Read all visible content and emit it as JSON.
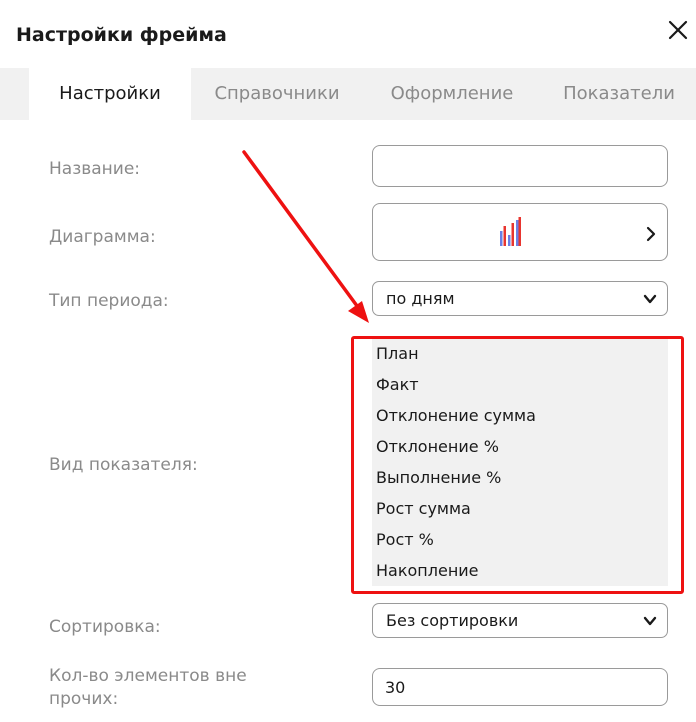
{
  "dialog": {
    "title": "Настройки фрейма"
  },
  "tabs": [
    {
      "label": "Настройки",
      "active": true
    },
    {
      "label": "Справочники",
      "active": false
    },
    {
      "label": "Оформление",
      "active": false
    },
    {
      "label": "Показатели",
      "active": false
    }
  ],
  "form": {
    "name_label": "Название:",
    "name_value": "",
    "diagram_label": "Диаграмма:",
    "period_label": "Тип периода:",
    "period_value": "по дням",
    "indicator_label": "Вид показателя:",
    "indicator_options": [
      "План",
      "Факт",
      "Отклонение сумма",
      "Отклонение %",
      "Выполнение %",
      "Рост сумма",
      "Рост %",
      "Накопление"
    ],
    "sort_label": "Сортировка:",
    "sort_value": "Без сортировки",
    "count_label_line1": "Кол-во элементов вне",
    "count_label_line2": "прочих:",
    "count_value": "30"
  },
  "colors": {
    "annotation_red": "#ee1111",
    "chart_icon_red": "#e8352f",
    "chart_icon_blue": "#6b7fe6",
    "panel_gray": "#f1f1f1",
    "label_gray": "#8a8a8a"
  },
  "icons": {
    "close": "close-icon",
    "diagram": "bar-chart-icon",
    "diagram_next": "chevron-right-icon",
    "select": "chevron-down-icon"
  }
}
